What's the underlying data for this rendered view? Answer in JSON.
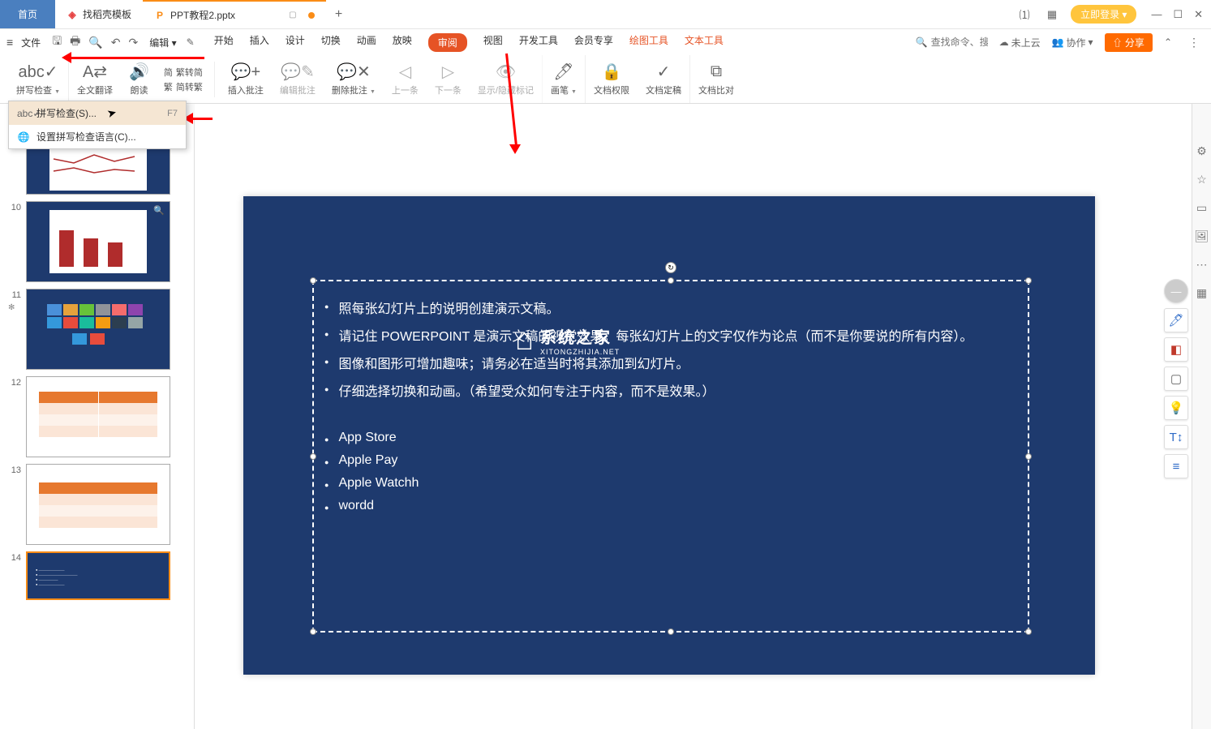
{
  "titlebar": {
    "home_tab": "首页",
    "template_tab": "找稻壳模板",
    "doc_tab": "PPT教程2.pptx",
    "login_btn": "立即登录"
  },
  "menubar": {
    "file": "文件",
    "edit": "编辑",
    "items": [
      "开始",
      "插入",
      "设计",
      "切换",
      "动画",
      "放映",
      "审阅",
      "视图",
      "开发工具",
      "会员专享"
    ],
    "tool1": "绘图工具",
    "tool2": "文本工具",
    "search_hint": "查找命令、搜索模板",
    "cloud": "未上云",
    "coop": "协作",
    "share": "分享"
  },
  "ribbon": {
    "spellcheck": "拼写检查",
    "fulltrans": "全文翻译",
    "read": "朗读",
    "s2t_simp": "繁转简",
    "s2t_trad": "简转繁",
    "insert_comment": "插入批注",
    "edit_comment": "编辑批注",
    "delete_comment": "删除批注",
    "prev": "上一条",
    "next": "下一条",
    "show_markup": "显示/隐藏标记",
    "pen": "画笔",
    "doc_perm": "文档权限",
    "doc_final": "文档定稿",
    "doc_compare": "文档比对"
  },
  "dropdown": {
    "item1": "拼写检查(S)...",
    "item1_key": "F7",
    "item2": "设置拼写检查语言(C)..."
  },
  "thumbs": {
    "n10": "10",
    "n11": "11",
    "n12": "12",
    "n13": "13",
    "n14": "14"
  },
  "slide": {
    "line1": "照每张幻灯片上的说明创建演示文稿。",
    "line2": "请记住 POWERPOINT 是演示文稿的视觉效果。每张幻灯片上的文字仅作为论点（而不是你要说的所有内容）。",
    "line3": "图像和图形可增加趣味；请务必在适当时将其添加到幻灯片。",
    "line4": "仔细选择切换和动画。（希望受众如何专注于内容，而不是效果。）",
    "line5": "App Store",
    "line6": "Apple Pay",
    "line7": "Apple Watchh",
    "line8": "wordd"
  },
  "watermark": {
    "main": "系统之家",
    "sub": "XITONGZHIJIA.NET"
  }
}
